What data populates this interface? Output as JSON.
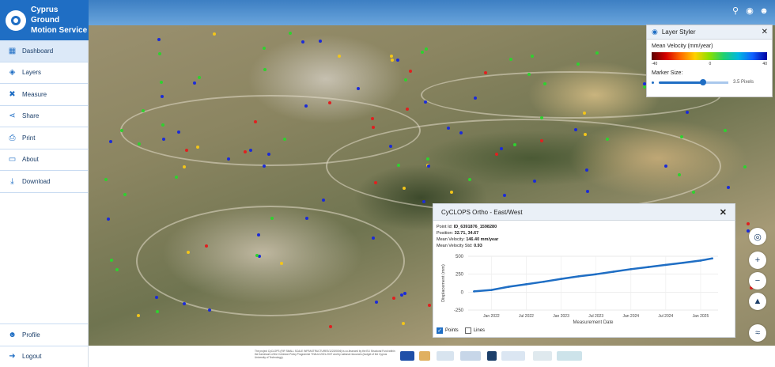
{
  "brand": {
    "title_line1": "Cyprus Ground",
    "title_line2": "Motion Service"
  },
  "top_icons": [
    "search-icon",
    "palette-icon",
    "user-icon"
  ],
  "sidebar": {
    "items": [
      {
        "label": "Dashboard",
        "icon": "dashboard-icon",
        "active": true
      },
      {
        "label": "Layers",
        "icon": "layers-icon"
      },
      {
        "label": "Measure",
        "icon": "measure-icon"
      },
      {
        "label": "Share",
        "icon": "share-icon"
      },
      {
        "label": "Print",
        "icon": "print-icon"
      },
      {
        "label": "About",
        "icon": "book-icon"
      },
      {
        "label": "Download",
        "icon": "download-icon"
      }
    ],
    "bottom": [
      {
        "label": "Profile",
        "icon": "person-icon"
      },
      {
        "label": "Logout",
        "icon": "logout-icon"
      }
    ]
  },
  "layer_styler": {
    "title": "Layer Styler",
    "velocity_label": "Mean Velocity (mm/year)",
    "ticks": [
      "-40",
      "0",
      "40"
    ],
    "marker_label": "Marker Size:",
    "marker_value": "3.5 Pixels",
    "marker_fraction": 0.6
  },
  "popup": {
    "title": "CyCLOPS Ortho - East/West",
    "point_id_label": "Point Id:",
    "point_id": "ID_6391876_1598280",
    "position_label": "Position:",
    "position": "32.71, 34.67",
    "velocity_label": "Mean Velocity:",
    "velocity": "146.40 mm/year",
    "std_label": "Mean Velocity Std:",
    "std": "0.93",
    "points_label": "Points",
    "lines_label": "Lines"
  },
  "chart_data": {
    "type": "line",
    "xlabel": "Measurement Date",
    "ylabel": "Displacement (mm)",
    "ylim": [
      -250,
      500
    ],
    "yticks": [
      500,
      250,
      0,
      -250
    ],
    "xticks": [
      "Jan 2022",
      "Jul 2022",
      "Jan 2023",
      "Jul 2023",
      "Jan 2024",
      "Jul 2024",
      "Jan 2025"
    ],
    "x": [
      "2021-10",
      "2022-01",
      "2022-04",
      "2022-07",
      "2022-10",
      "2023-01",
      "2023-04",
      "2023-07",
      "2023-10",
      "2024-01",
      "2024-04",
      "2024-07",
      "2024-10",
      "2025-01",
      "2025-03"
    ],
    "series": [
      {
        "values": [
          10,
          30,
          75,
          110,
          145,
          185,
          220,
          250,
          285,
          320,
          350,
          380,
          410,
          440,
          470
        ]
      }
    ],
    "color": "#1f6ec4",
    "grid": true
  },
  "footer": {
    "text": "The project CyCLOPS (RIF SMALL SCALE INFRASTRUCTURES/1222/0006) is co-financed by the EU Structural Fund within the framework of the Cohesion Policy Programme THALIA 2021-2027 and by national resources (budget of the Cyprus University of Technology)."
  },
  "map_controls": [
    "locate-icon",
    "zoom-in-icon",
    "zoom-out-icon",
    "compass-icon",
    "basemap-icon"
  ],
  "colors": {
    "primary": "#1f6ec4",
    "sidebar_text": "#1c3f6a"
  }
}
